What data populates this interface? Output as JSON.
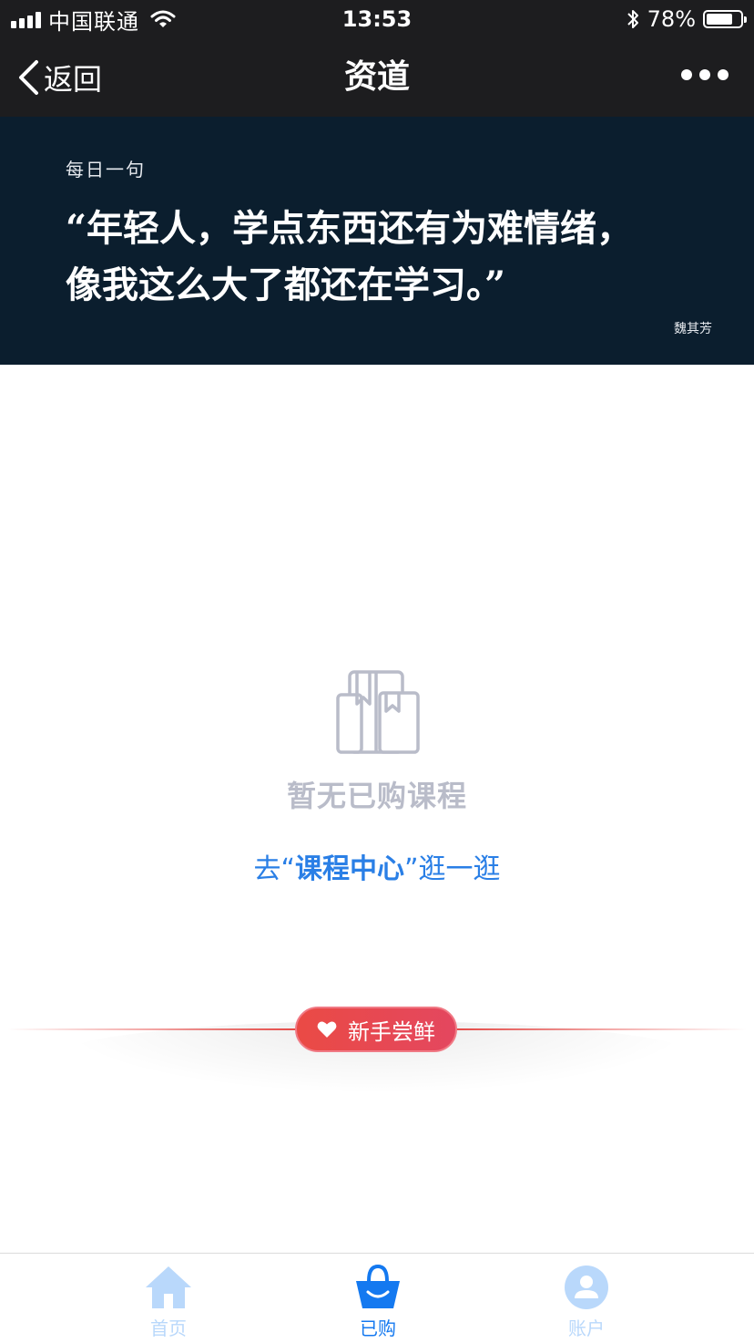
{
  "status_bar": {
    "carrier": "中国联通",
    "time": "13:53",
    "battery_percent": "78%",
    "battery_level": 0.78,
    "icons": [
      "signal-icon",
      "wifi-icon",
      "bluetooth-icon",
      "battery-icon"
    ]
  },
  "nav": {
    "back_label": "返回",
    "title": "资道",
    "more_icon": "more-dots-icon"
  },
  "banner": {
    "label": "每日一句",
    "quote_lines": [
      "“年轻人，学点东西还有为难情绪，",
      "像我这么大了都还在学习。”"
    ],
    "author": "魏其芳",
    "background": "#0b1e2e"
  },
  "empty_state": {
    "icon": "books-icon",
    "text": "暂无已购课程",
    "link_prefix": "去“",
    "link_strong": "课程中心",
    "link_suffix": "”逛一逛",
    "link_color": "#2a7fe6"
  },
  "promo": {
    "label": "新手尝鲜",
    "icon": "heart-icon",
    "color": "#e9484f"
  },
  "tabbar": {
    "tabs": [
      {
        "label": "首页",
        "icon": "home-icon",
        "active": false
      },
      {
        "label": "已购",
        "icon": "shopping-bag-icon",
        "active": true
      },
      {
        "label": "账户",
        "icon": "user-icon",
        "active": false
      }
    ],
    "active_color": "#1479f0",
    "inactive_color": "#b9d8fb"
  }
}
